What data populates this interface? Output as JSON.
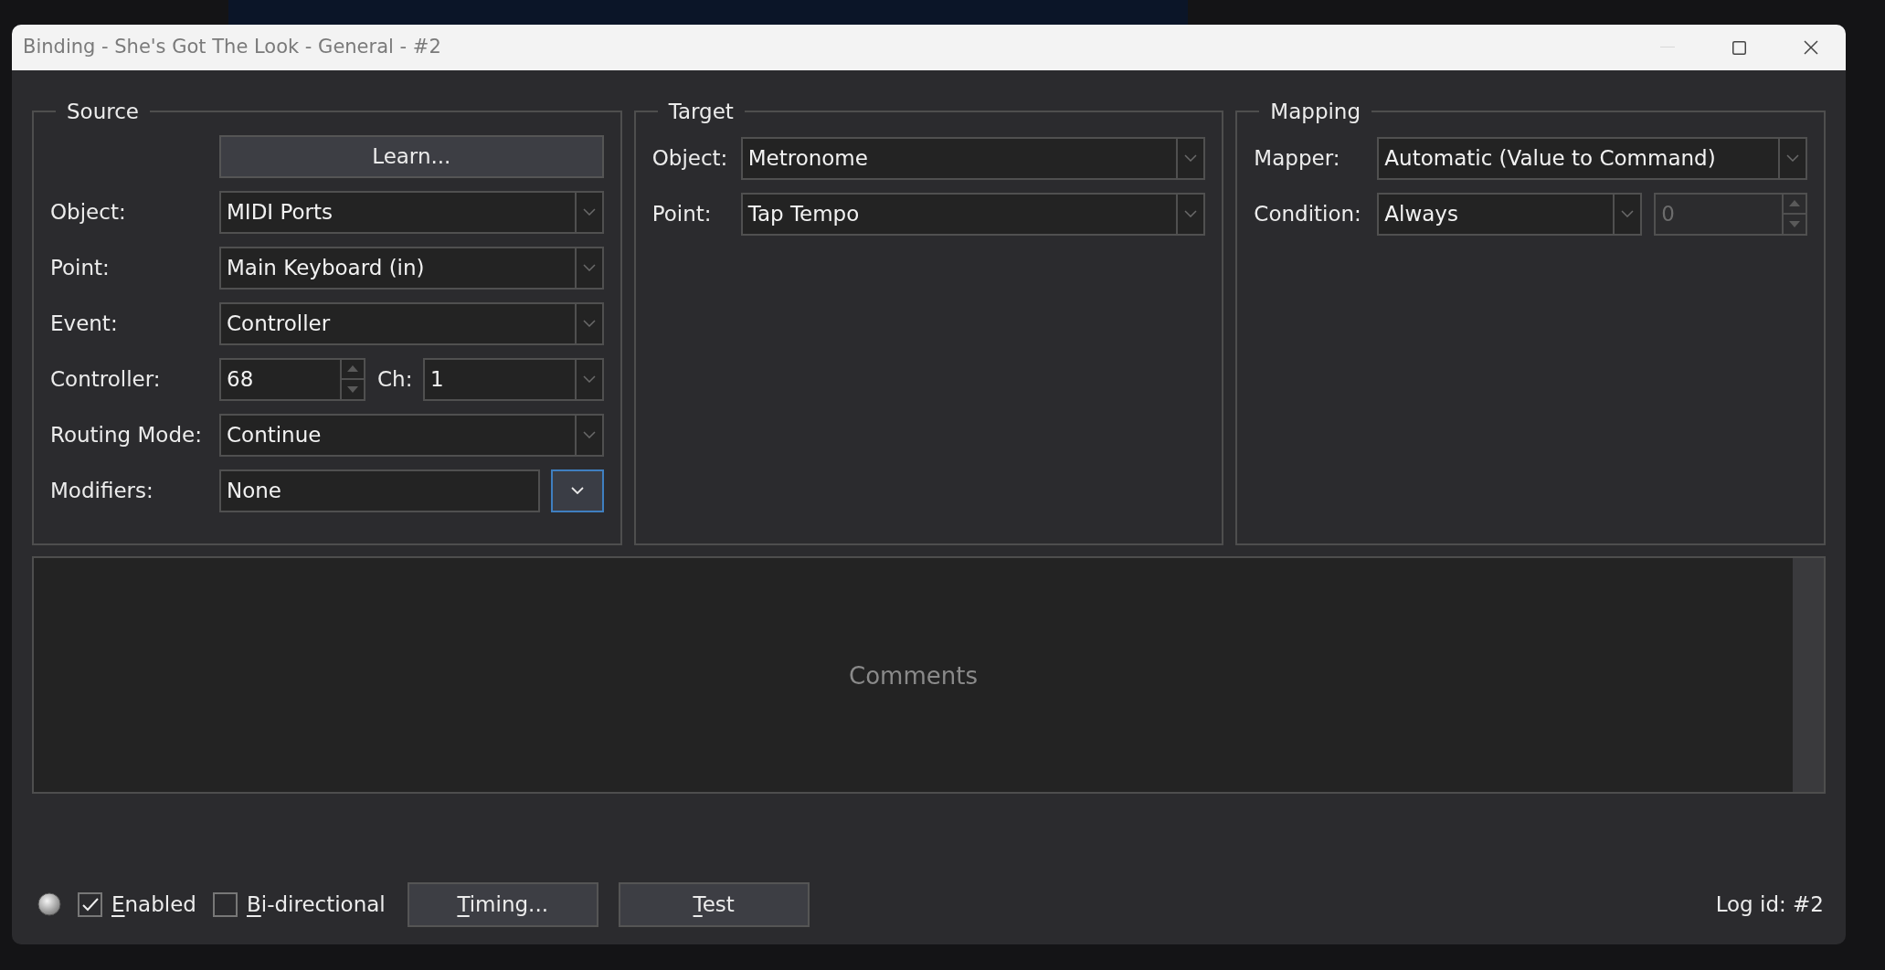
{
  "window": {
    "title": "Binding - She's Got The Look - General - #2"
  },
  "source": {
    "title": "Source",
    "learn_button": "Learn...",
    "fields": [
      {
        "kind": "dropdown",
        "label": "Object:",
        "value": "MIDI Ports"
      },
      {
        "kind": "dropdown",
        "label": "Point:",
        "value": "Main Keyboard (in)"
      },
      {
        "kind": "dropdown",
        "label": "Event:",
        "value": "Controller"
      },
      {
        "kind": "spin_channel",
        "label": "Controller:",
        "value": "68",
        "channel_label": "Ch:",
        "channel_value": "1"
      },
      {
        "kind": "dropdown",
        "label": "Routing Mode:",
        "value": "Continue"
      },
      {
        "kind": "text_button",
        "label": "Modifiers:",
        "value": "None"
      }
    ]
  },
  "target": {
    "title": "Target",
    "fields": [
      {
        "kind": "dropdown",
        "label": "Object:",
        "value": "Metronome"
      },
      {
        "kind": "dropdown",
        "label": "Point:",
        "value": "Tap Tempo"
      }
    ]
  },
  "mapping": {
    "title": "Mapping",
    "fields": [
      {
        "kind": "dropdown",
        "label": "Mapper:",
        "value": "Automatic (Value to Command)"
      },
      {
        "kind": "dropdown_spin",
        "label": "Condition:",
        "value": "Always",
        "spin_value": "0",
        "spin_disabled": true
      }
    ]
  },
  "comments": {
    "placeholder": "Comments"
  },
  "footer": {
    "checkboxes": [
      {
        "label": "Enabled",
        "checked": true
      },
      {
        "label": "Bi-directional",
        "checked": false
      }
    ],
    "buttons": [
      "Timing...",
      "Test"
    ],
    "log_id": "Log id: #2"
  }
}
